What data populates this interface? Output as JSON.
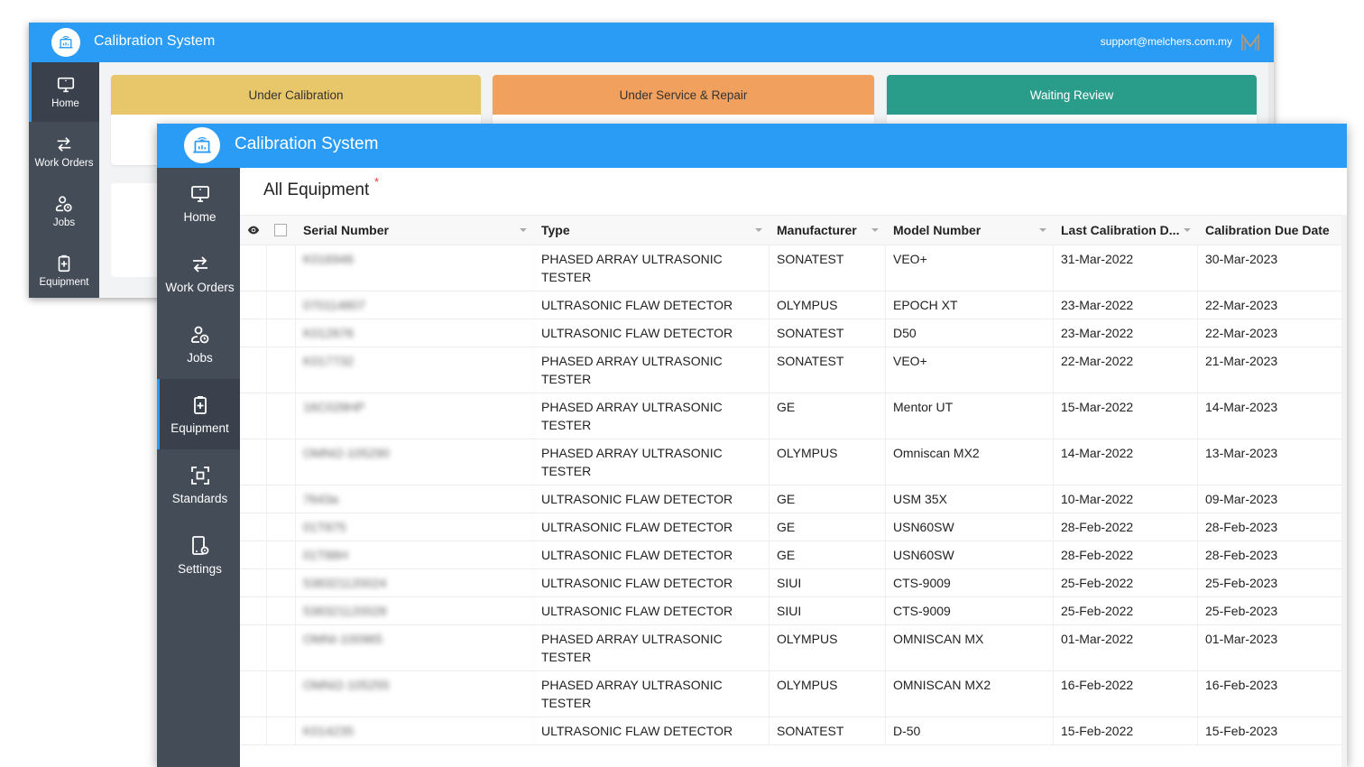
{
  "back_window": {
    "app_title": "Calibration System",
    "support_email": "support@melchers.com.my",
    "brand_icon": "melchers-m-logo",
    "sidebar": [
      {
        "label": "Home",
        "icon": "monitor-icon",
        "active": true
      },
      {
        "label": "Work Orders",
        "icon": "swap-arrows-icon",
        "active": false
      },
      {
        "label": "Jobs",
        "icon": "user-clock-icon",
        "active": false
      },
      {
        "label": "Equipment",
        "icon": "clipboard-plus-icon",
        "active": false
      }
    ],
    "status_cards": [
      {
        "label": "Under Calibration",
        "color": "#e8c66a"
      },
      {
        "label": "Under Service & Repair",
        "color": "#f2a05e"
      },
      {
        "label": "Waiting Review",
        "color": "#2a9c8a"
      }
    ]
  },
  "front_window": {
    "app_title": "Calibration System",
    "accent_color": "#2b9cf5",
    "sidebar": [
      {
        "label": "Home",
        "icon": "monitor-icon",
        "active": false
      },
      {
        "label": "Work Orders",
        "icon": "swap-arrows-icon",
        "active": false
      },
      {
        "label": "Jobs",
        "icon": "user-clock-icon",
        "active": false
      },
      {
        "label": "Equipment",
        "icon": "clipboard-plus-icon",
        "active": true
      },
      {
        "label": "Standards",
        "icon": "focus-frame-icon",
        "active": false
      },
      {
        "label": "Settings",
        "icon": "device-gear-icon",
        "active": false
      }
    ],
    "page_title": "All Equipment",
    "required_marker": "*",
    "table": {
      "columns": [
        "Serial Number",
        "Type",
        "Manufacturer",
        "Model Number",
        "Last Calibration D...",
        "Calibration Due Date"
      ],
      "rows": [
        {
          "serial": "K016946",
          "type": "PHASED ARRAY ULTRASONIC TESTER",
          "manufacturer": "SONATEST",
          "model": "VEO+",
          "last": "31-Mar-2022",
          "due": "30-Mar-2023"
        },
        {
          "serial": "070114807",
          "type": "ULTRASONIC FLAW DETECTOR",
          "manufacturer": "OLYMPUS",
          "model": "EPOCH XT",
          "last": "23-Mar-2022",
          "due": "22-Mar-2023"
        },
        {
          "serial": "K012676",
          "type": "ULTRASONIC FLAW DETECTOR",
          "manufacturer": "SONATEST",
          "model": "D50",
          "last": "23-Mar-2022",
          "due": "22-Mar-2023"
        },
        {
          "serial": "K017732",
          "type": "PHASED ARRAY ULTRASONIC TESTER",
          "manufacturer": "SONATEST",
          "model": "VEO+",
          "last": "22-Mar-2022",
          "due": "21-Mar-2023"
        },
        {
          "serial": "16C028HP",
          "type": "PHASED ARRAY ULTRASONIC TESTER",
          "manufacturer": "GE",
          "model": "Mentor UT",
          "last": "15-Mar-2022",
          "due": "14-Mar-2023"
        },
        {
          "serial": "OMNI2-105290",
          "type": "PHASED ARRAY ULTRASONIC TESTER",
          "manufacturer": "OLYMPUS",
          "model": "Omniscan MX2",
          "last": "14-Mar-2022",
          "due": "13-Mar-2023"
        },
        {
          "serial": "7643a",
          "type": "ULTRASONIC FLAW DETECTOR",
          "manufacturer": "GE",
          "model": "USM 35X",
          "last": "10-Mar-2022",
          "due": "09-Mar-2023"
        },
        {
          "serial": "01T875",
          "type": "ULTRASONIC FLAW DETECTOR",
          "manufacturer": "GE",
          "model": "USN60SW",
          "last": "28-Feb-2022",
          "due": "28-Feb-2023"
        },
        {
          "serial": "01T88H",
          "type": "ULTRASONIC FLAW DETECTOR",
          "manufacturer": "GE",
          "model": "USN60SW",
          "last": "28-Feb-2022",
          "due": "28-Feb-2023"
        },
        {
          "serial": "538321120024",
          "type": "ULTRASONIC FLAW DETECTOR",
          "manufacturer": "SIUI",
          "model": "CTS-9009",
          "last": "25-Feb-2022",
          "due": "25-Feb-2023"
        },
        {
          "serial": "538321120028",
          "type": "ULTRASONIC FLAW DETECTOR",
          "manufacturer": "SIUI",
          "model": "CTS-9009",
          "last": "25-Feb-2022",
          "due": "25-Feb-2023"
        },
        {
          "serial": "OMNI-100965",
          "type": "PHASED ARRAY ULTRASONIC TESTER",
          "manufacturer": "OLYMPUS",
          "model": "OMNISCAN MX",
          "last": "01-Mar-2022",
          "due": "01-Mar-2023"
        },
        {
          "serial": "OMNI2-105255",
          "type": "PHASED ARRAY ULTRASONIC TESTER",
          "manufacturer": "OLYMPUS",
          "model": "OMNISCAN MX2",
          "last": "16-Feb-2022",
          "due": "16-Feb-2023"
        },
        {
          "serial": "K014235",
          "type": "ULTRASONIC FLAW DETECTOR",
          "manufacturer": "SONATEST",
          "model": "D-50",
          "last": "15-Feb-2022",
          "due": "15-Feb-2023"
        }
      ]
    }
  }
}
